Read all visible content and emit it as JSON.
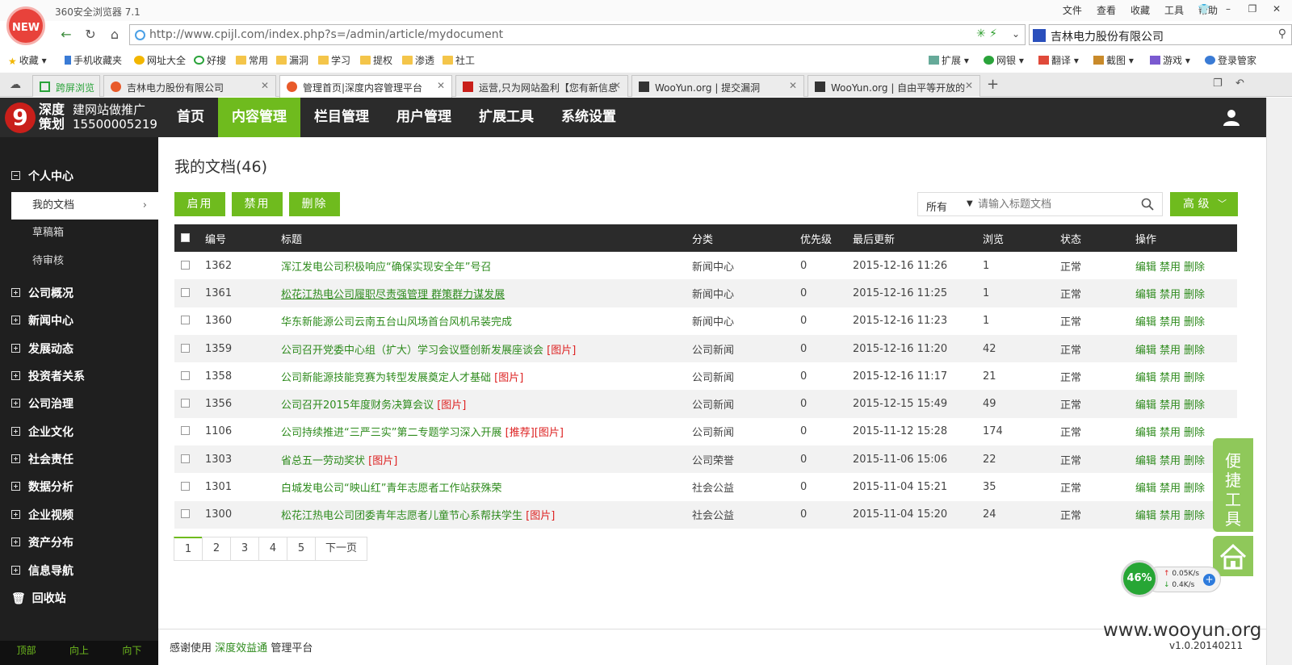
{
  "browser": {
    "logo_text": "NEW",
    "name": "360安全浏览器 7.1",
    "menu": [
      "文件",
      "查看",
      "收藏",
      "工具",
      "帮助"
    ],
    "address": "http://www.cpijl.com/index.php?s=/admin/article/mydocument",
    "search_value": "吉林电力股份有限公司",
    "favorites": [
      "收藏",
      "手机收藏夹",
      "网址大全",
      "好搜",
      "常用",
      "漏洞",
      "学习",
      "提权",
      "渗透",
      "社工"
    ],
    "extensions": [
      "扩展",
      "网银",
      "翻译",
      "截图",
      "游戏",
      "登录管家"
    ],
    "tabs": [
      {
        "label": "跨屏浏览"
      },
      {
        "label": "吉林电力股份有限公司"
      },
      {
        "label": "管理首页|深度内容管理平台"
      },
      {
        "label": "运营,只为网站盈利【您有新信息"
      },
      {
        "label": "WooYun.org | 提交漏洞"
      },
      {
        "label": "WooYun.org | 自由平等开放的"
      }
    ]
  },
  "brand": {
    "logo": "9",
    "name": "深度策划",
    "tagline1": "建网站做推广",
    "tagline2": "15500005219"
  },
  "main_nav": [
    "首页",
    "内容管理",
    "栏目管理",
    "用户管理",
    "扩展工具",
    "系统设置"
  ],
  "sidebar": {
    "personal": "个人中心",
    "subs": [
      "我的文档",
      "草稿箱",
      "待审核"
    ],
    "groups": [
      "公司概况",
      "新闻中心",
      "发展动态",
      "投资者关系",
      "公司治理",
      "企业文化",
      "社会责任",
      "数据分析",
      "企业视频",
      "资产分布",
      "信息导航"
    ],
    "recycle": "回收站",
    "footer": [
      "顶部",
      "向上",
      "向下"
    ]
  },
  "content": {
    "title": "我的文档(46)",
    "buttons": [
      "启用",
      "禁用",
      "删除"
    ],
    "filter_select": "所有",
    "filter_placeholder": "请输入标题文档",
    "advanced": "高 级",
    "columns": [
      "编号",
      "标题",
      "分类",
      "优先级",
      "最后更新",
      "浏览",
      "状态",
      "操作"
    ],
    "ops": [
      "编辑",
      "禁用",
      "删除"
    ],
    "rows": [
      {
        "id": "1362",
        "title": "浑江发电公司积极响应“确保实现安全年”号召",
        "tags": "",
        "cat": "新闻中心",
        "pri": "0",
        "updated": "2015-12-16 11:26",
        "views": "1",
        "status": "正常"
      },
      {
        "id": "1361",
        "title": "松花江热电公司履职尽责强管理 群策群力谋发展",
        "tags": "",
        "cat": "新闻中心",
        "pri": "0",
        "updated": "2015-12-16 11:25",
        "views": "1",
        "status": "正常"
      },
      {
        "id": "1360",
        "title": "华东新能源公司云南五台山风场首台风机吊装完成",
        "tags": "",
        "cat": "新闻中心",
        "pri": "0",
        "updated": "2015-12-16 11:23",
        "views": "1",
        "status": "正常"
      },
      {
        "id": "1359",
        "title": "公司召开党委中心组（扩大）学习会议暨创新发展座谈会",
        "tags": "[图片]",
        "cat": "公司新闻",
        "pri": "0",
        "updated": "2015-12-16 11:20",
        "views": "42",
        "status": "正常"
      },
      {
        "id": "1358",
        "title": "公司新能源技能竞赛为转型发展奠定人才基础",
        "tags": "[图片]",
        "cat": "公司新闻",
        "pri": "0",
        "updated": "2015-12-16 11:17",
        "views": "21",
        "status": "正常"
      },
      {
        "id": "1356",
        "title": "公司召开2015年度财务决算会议",
        "tags": "[图片]",
        "cat": "公司新闻",
        "pri": "0",
        "updated": "2015-12-15 15:49",
        "views": "49",
        "status": "正常"
      },
      {
        "id": "1106",
        "title": "公司持续推进“三严三实”第二专题学习深入开展",
        "tags": "[推荐][图片]",
        "cat": "公司新闻",
        "pri": "0",
        "updated": "2015-11-12 15:28",
        "views": "174",
        "status": "正常"
      },
      {
        "id": "1303",
        "title": "省总五一劳动奖状",
        "tags": "[图片]",
        "cat": "公司荣誉",
        "pri": "0",
        "updated": "2015-11-06 15:06",
        "views": "22",
        "status": "正常"
      },
      {
        "id": "1301",
        "title": "白城发电公司“映山红”青年志愿者工作站获殊荣",
        "tags": "",
        "cat": "社会公益",
        "pri": "0",
        "updated": "2015-11-04 15:21",
        "views": "35",
        "status": "正常"
      },
      {
        "id": "1300",
        "title": "松花江热电公司团委青年志愿者儿童节心系帮扶学生",
        "tags": "[图片]",
        "cat": "社会公益",
        "pri": "0",
        "updated": "2015-11-04 15:20",
        "views": "24",
        "status": "正常"
      }
    ],
    "pages": [
      "1",
      "2",
      "3",
      "4",
      "5",
      "下一页"
    ]
  },
  "footer": {
    "pre": "感谢使用",
    "link": "深度效益通",
    "post": "管理平台",
    "watermark": "www.wooyun.org",
    "version": "v1.0.20140211"
  },
  "widgets": {
    "quick_tools": "便捷工具",
    "speed_percent": "46%",
    "speed_up": "0.05K/s",
    "speed_down": "0.4K/s"
  },
  "colors": {
    "accent": "#6fbb1e",
    "header_bg": "#2b2b2b",
    "sidebar_bg": "#1f1f1f",
    "link": "#2e8b1d",
    "tag": "#dd2222"
  }
}
